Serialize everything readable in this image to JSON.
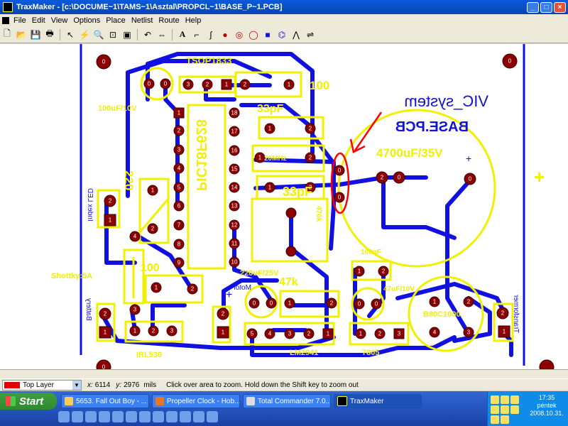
{
  "window": {
    "title": "TraxMaker - [c:\\DOCUME~1\\TAMS~1\\Asztal\\PROPCL~1\\BASE_P~1.PCB]",
    "min": "_",
    "max": "□",
    "close": "×"
  },
  "menu": [
    "File",
    "Edit",
    "View",
    "Options",
    "Place",
    "Netlist",
    "Route",
    "Help"
  ],
  "toolbar_icons": [
    "open-icon",
    "folder-icon",
    "save-icon",
    "print-icon",
    "pointer-icon",
    "route-icon",
    "zoom-icon",
    "zoom-area-icon",
    "zoom-fit-icon",
    "undo-icon",
    "redo-icon",
    "text-icon",
    "track-icon",
    "arc-icon",
    "pad-icon",
    "via-icon",
    "circle-icon",
    "fill-icon",
    "component-icon",
    "net-icon",
    "arrow-icon"
  ],
  "pcb": {
    "labels": {
      "tsop": "TSOP1833",
      "cap100uf": "100uF/10V",
      "pic": "PIC18F628",
      "c33pf_a": "33pF",
      "c20mhz": "20MHz",
      "c33pf_b": "33pF",
      "r100": "100",
      "vic": "VIC_system",
      "base": "BASE.PCB",
      "c4700": "4700uF/35V",
      "plus": "+",
      "r220": "220",
      "index_led": "Index LED",
      "r470k": "470k",
      "c100nf": "100nF",
      "shottky": "Shottky:5A",
      "r100b": "100",
      "c220": "220uF/25V",
      "r47k": "47k",
      "motor": "Motor",
      "c47": "47uF/10V",
      "plus2": "+",
      "b80": "B80C1000",
      "transformer": "Transformer",
      "battery": "Battery",
      "irl": "IRL530",
      "lm": "LM2941",
      "reg": "7805",
      "pad0": "0",
      "pad1": "1",
      "pad2": "2",
      "pad3": "3",
      "pad4": "4",
      "pad5": "5",
      "pad6": "6",
      "pad7": "7",
      "pad8": "8",
      "pad9": "9",
      "pad10": "10",
      "pad11": "11",
      "pad12": "12",
      "pad13": "13",
      "pad14": "14",
      "pad15": "15",
      "pad16": "16",
      "pad17": "17",
      "pad18": "18"
    }
  },
  "status": {
    "layer": "Top Layer",
    "layer_color": "#e00000",
    "x_label": "x:",
    "x_value": "6114",
    "y_label": "y:",
    "y_value": "2976",
    "units": "mils",
    "hint": "Click over area to zoom.  Hold down the Shift key to zoom out"
  },
  "taskbar": {
    "start": "Start",
    "items": [
      "5653. Fall Out Boy - ...",
      "Propeller Clock - Hob...",
      "Total Commander 7.0...",
      "TraxMaker"
    ],
    "time": "17:35",
    "day": "péntek",
    "date": "2008.10.31."
  },
  "colors": {
    "track": "#1010e0",
    "pad": "#8b0000",
    "silk": "#f0f000",
    "annotation": "#ff0000"
  }
}
